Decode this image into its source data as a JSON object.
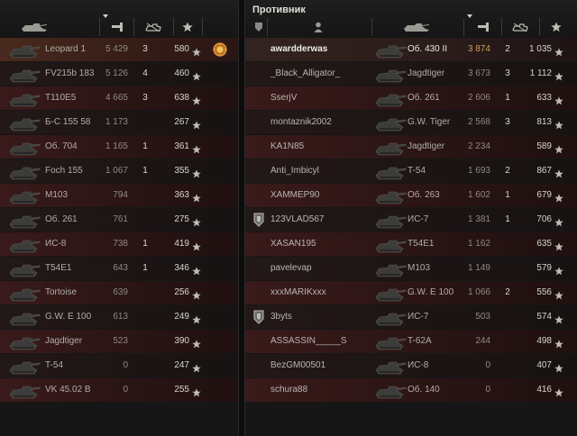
{
  "enemy_team_title": "Противник",
  "icons": {
    "tank": "tank-icon",
    "vehicle_column": "tank-silhouette-icon",
    "damage_column": "damage-icon",
    "kills_column": "destroyed-tank-icon",
    "xp_column": "star-icon",
    "player_column": "player-icon",
    "platoon": "platoon-badge-icon",
    "medal": "medal-icon"
  },
  "colors": {
    "own_highlight": "#4a2a1e",
    "enemy_row": "#3a1a1a",
    "damage_highlight": "#d0a060"
  },
  "left_team": [
    {
      "vehicle": "Leopard 1",
      "damage": "5 429",
      "kills": "3",
      "xp": "580",
      "medal": true
    },
    {
      "vehicle": "FV215b 183",
      "damage": "5 126",
      "kills": "4",
      "xp": "460"
    },
    {
      "vehicle": "T110E5",
      "damage": "4 665",
      "kills": "3",
      "xp": "638"
    },
    {
      "vehicle": "Б-С 155 58",
      "damage": "1 173",
      "kills": "",
      "xp": "267"
    },
    {
      "vehicle": "Об. 704",
      "damage": "1 165",
      "kills": "1",
      "xp": "361"
    },
    {
      "vehicle": "Foch 155",
      "damage": "1 067",
      "kills": "1",
      "xp": "355"
    },
    {
      "vehicle": "M103",
      "damage": "794",
      "kills": "",
      "xp": "363"
    },
    {
      "vehicle": "Об. 261",
      "damage": "761",
      "kills": "",
      "xp": "275"
    },
    {
      "vehicle": "ИС-8",
      "damage": "738",
      "kills": "1",
      "xp": "419"
    },
    {
      "vehicle": "T54E1",
      "damage": "643",
      "kills": "1",
      "xp": "346"
    },
    {
      "vehicle": "Tortoise",
      "damage": "639",
      "kills": "",
      "xp": "256"
    },
    {
      "vehicle": "G.W. E 100",
      "damage": "613",
      "kills": "",
      "xp": "249"
    },
    {
      "vehicle": "Jagdtiger",
      "damage": "523",
      "kills": "",
      "xp": "390"
    },
    {
      "vehicle": "T-54",
      "damage": "0",
      "kills": "",
      "xp": "247"
    },
    {
      "vehicle": "VK 45.02 B",
      "damage": "0",
      "kills": "",
      "xp": "255"
    }
  ],
  "right_team": [
    {
      "player": "awardderwas",
      "vehicle": "Об. 430 II",
      "damage": "3 874",
      "kills": "2",
      "xp": "1 035",
      "highlight": true
    },
    {
      "player": "_Black_Alligator_",
      "vehicle": "Jagdtiger",
      "damage": "3 673",
      "kills": "3",
      "xp": "1 112"
    },
    {
      "player": "SserjV",
      "vehicle": "Об. 261",
      "damage": "2 606",
      "kills": "1",
      "xp": "633"
    },
    {
      "player": "montaznik2002",
      "vehicle": "G.W. Tiger",
      "damage": "2 568",
      "kills": "3",
      "xp": "813"
    },
    {
      "player": "KA1N85",
      "vehicle": "Jagdtiger",
      "damage": "2 234",
      "kills": "",
      "xp": "589"
    },
    {
      "player": "Anti_Imbicyl",
      "vehicle": "T-54",
      "damage": "1 693",
      "kills": "2",
      "xp": "867"
    },
    {
      "player": "XAMMEP90",
      "vehicle": "Об. 263",
      "damage": "1 602",
      "kills": "1",
      "xp": "679"
    },
    {
      "player": "123VLAD567",
      "vehicle": "ИС-7",
      "damage": "1 381",
      "kills": "1",
      "xp": "706",
      "platoon": true
    },
    {
      "player": "XASAN195",
      "vehicle": "T54E1",
      "damage": "1 162",
      "kills": "",
      "xp": "635"
    },
    {
      "player": "pavelevap",
      "vehicle": "M103",
      "damage": "1 149",
      "kills": "",
      "xp": "579"
    },
    {
      "player": "xxxMARIKxxx",
      "vehicle": "G.W. E 100",
      "damage": "1 066",
      "kills": "2",
      "xp": "556"
    },
    {
      "player": "3byts",
      "vehicle": "ИС-7",
      "damage": "503",
      "kills": "",
      "xp": "574",
      "platoon": true
    },
    {
      "player": "ASSASSIN_____S",
      "vehicle": "T-62A",
      "damage": "244",
      "kills": "",
      "xp": "498"
    },
    {
      "player": "BezGM00501",
      "vehicle": "ИС-8",
      "damage": "0",
      "kills": "",
      "xp": "407"
    },
    {
      "player": "schura88",
      "vehicle": "Об. 140",
      "damage": "0",
      "kills": "",
      "xp": "416"
    }
  ]
}
